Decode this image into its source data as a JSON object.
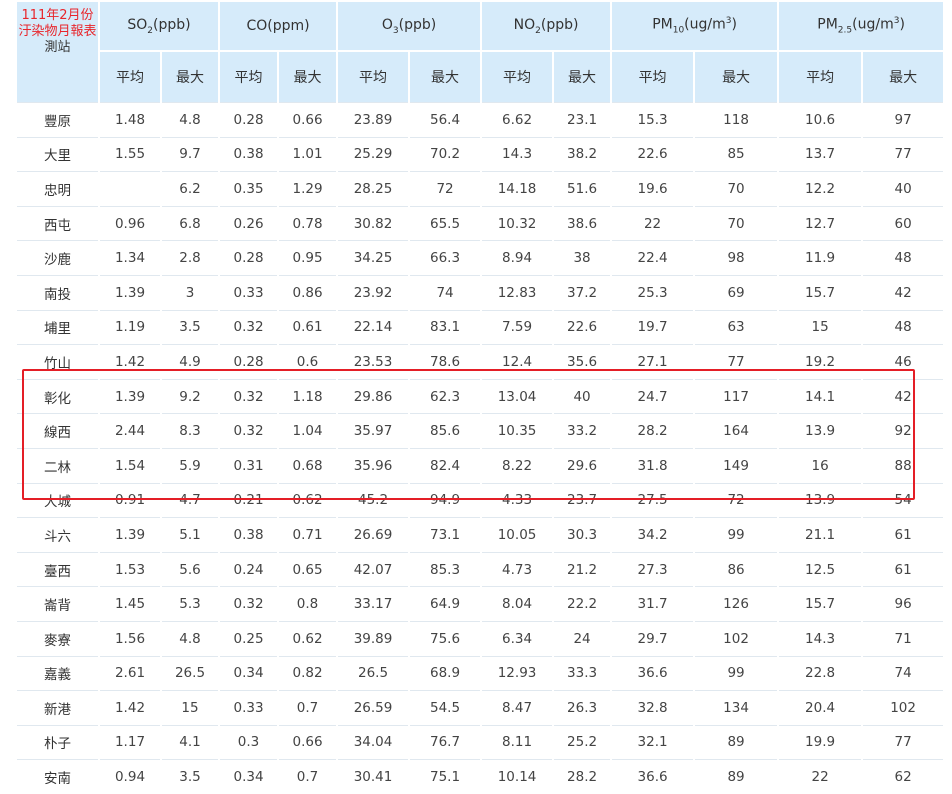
{
  "title_line1": "111年2月份",
  "title_line2": "汙染物月報表",
  "station_label": "測站",
  "pollutants": [
    {
      "base": "SO",
      "sub": "2",
      "sup": "",
      "tail": "(ppb)"
    },
    {
      "base": "CO",
      "sub": "",
      "sup": "",
      "tail": "(ppm)"
    },
    {
      "base": "O",
      "sub": "3",
      "sup": "",
      "tail": "(ppb)"
    },
    {
      "base": "NO",
      "sub": "2",
      "sup": "",
      "tail": "(ppb)"
    },
    {
      "base": "PM",
      "sub": "10",
      "sup": "3",
      "tail": "(ug/m",
      "close": ")"
    },
    {
      "base": "PM",
      "sub": "2.5",
      "sup": "3",
      "tail": "(ug/m",
      "close": ")"
    }
  ],
  "sub_headers": [
    "平均",
    "最大"
  ],
  "rows": [
    [
      "豐原",
      "1.48",
      "4.8",
      "0.28",
      "0.66",
      "23.89",
      "56.4",
      "6.62",
      "23.1",
      "15.3",
      "118",
      "10.6",
      "97"
    ],
    [
      "大里",
      "1.55",
      "9.7",
      "0.38",
      "1.01",
      "25.29",
      "70.2",
      "14.3",
      "38.2",
      "22.6",
      "85",
      "13.7",
      "77"
    ],
    [
      "忠明",
      "",
      "6.2",
      "0.35",
      "1.29",
      "28.25",
      "72",
      "14.18",
      "51.6",
      "19.6",
      "70",
      "12.2",
      "40"
    ],
    [
      "西屯",
      "0.96",
      "6.8",
      "0.26",
      "0.78",
      "30.82",
      "65.5",
      "10.32",
      "38.6",
      "22",
      "70",
      "12.7",
      "60"
    ],
    [
      "沙鹿",
      "1.34",
      "2.8",
      "0.28",
      "0.95",
      "34.25",
      "66.3",
      "8.94",
      "38",
      "22.4",
      "98",
      "11.9",
      "48"
    ],
    [
      "南投",
      "1.39",
      "3",
      "0.33",
      "0.86",
      "23.92",
      "74",
      "12.83",
      "37.2",
      "25.3",
      "69",
      "15.7",
      "42"
    ],
    [
      "埔里",
      "1.19",
      "3.5",
      "0.32",
      "0.61",
      "22.14",
      "83.1",
      "7.59",
      "22.6",
      "19.7",
      "63",
      "15",
      "48"
    ],
    [
      "竹山",
      "1.42",
      "4.9",
      "0.28",
      "0.6",
      "23.53",
      "78.6",
      "12.4",
      "35.6",
      "27.1",
      "77",
      "19.2",
      "46"
    ],
    [
      "彰化",
      "1.39",
      "9.2",
      "0.32",
      "1.18",
      "29.86",
      "62.3",
      "13.04",
      "40",
      "24.7",
      "117",
      "14.1",
      "42"
    ],
    [
      "線西",
      "2.44",
      "8.3",
      "0.32",
      "1.04",
      "35.97",
      "85.6",
      "10.35",
      "33.2",
      "28.2",
      "164",
      "13.9",
      "92"
    ],
    [
      "二林",
      "1.54",
      "5.9",
      "0.31",
      "0.68",
      "35.96",
      "82.4",
      "8.22",
      "29.6",
      "31.8",
      "149",
      "16",
      "88"
    ],
    [
      "大城",
      "0.91",
      "4.7",
      "0.21",
      "0.62",
      "45.2",
      "94.9",
      "4.33",
      "23.7",
      "27.5",
      "72",
      "13.9",
      "54"
    ],
    [
      "斗六",
      "1.39",
      "5.1",
      "0.38",
      "0.71",
      "26.69",
      "73.1",
      "10.05",
      "30.3",
      "34.2",
      "99",
      "21.1",
      "61"
    ],
    [
      "臺西",
      "1.53",
      "5.6",
      "0.24",
      "0.65",
      "42.07",
      "85.3",
      "4.73",
      "21.2",
      "27.3",
      "86",
      "12.5",
      "61"
    ],
    [
      "崙背",
      "1.45",
      "5.3",
      "0.32",
      "0.8",
      "33.17",
      "64.9",
      "8.04",
      "22.2",
      "31.7",
      "126",
      "15.7",
      "96"
    ],
    [
      "麥寮",
      "1.56",
      "4.8",
      "0.25",
      "0.62",
      "39.89",
      "75.6",
      "6.34",
      "24",
      "29.7",
      "102",
      "14.3",
      "71"
    ],
    [
      "嘉義",
      "2.61",
      "26.5",
      "0.34",
      "0.82",
      "26.5",
      "68.9",
      "12.93",
      "33.3",
      "36.6",
      "99",
      "22.8",
      "74"
    ],
    [
      "新港",
      "1.42",
      "15",
      "0.33",
      "0.7",
      "26.59",
      "54.5",
      "8.47",
      "26.3",
      "32.8",
      "134",
      "20.4",
      "102"
    ],
    [
      "朴子",
      "1.17",
      "4.1",
      "0.3",
      "0.66",
      "34.04",
      "76.7",
      "8.11",
      "25.2",
      "32.1",
      "89",
      "19.9",
      "77"
    ],
    [
      "安南",
      "0.94",
      "3.5",
      "0.34",
      "0.7",
      "30.41",
      "75.1",
      "10.14",
      "28.2",
      "36.6",
      "89",
      "22",
      "62"
    ]
  ],
  "highlight_color": "#e41e26",
  "header_bg": "#d6ebfa"
}
